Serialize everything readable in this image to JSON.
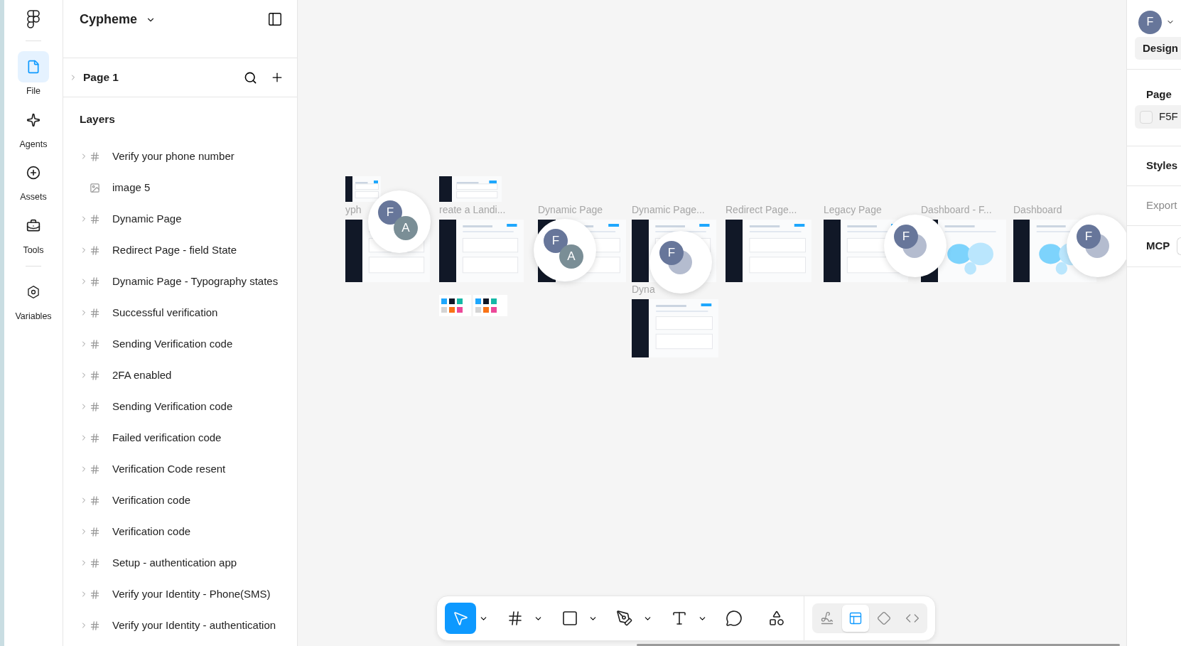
{
  "rail": {
    "items": [
      {
        "kind": "file",
        "label": "File",
        "selected": true
      },
      {
        "kind": "agents",
        "label": "Agents",
        "selected": false
      },
      {
        "kind": "assets",
        "label": "Assets",
        "selected": false
      },
      {
        "kind": "tools",
        "label": "Tools",
        "selected": false
      },
      {
        "kind": "variables",
        "label": "Variables",
        "selected": false
      }
    ]
  },
  "file": {
    "title": "Cypheme"
  },
  "page_row": {
    "label": "Page 1"
  },
  "layers": {
    "title": "Layers",
    "items": [
      {
        "kind": "frame",
        "label": "Verify your phone number"
      },
      {
        "kind": "image",
        "label": "image 5"
      },
      {
        "kind": "frame",
        "label": "Dynamic Page"
      },
      {
        "kind": "frame",
        "label": "Redirect Page - field State"
      },
      {
        "kind": "frame",
        "label": "Dynamic Page - Typography states"
      },
      {
        "kind": "frame",
        "label": "Successful verification"
      },
      {
        "kind": "frame",
        "label": "Sending Verification code"
      },
      {
        "kind": "frame",
        "label": "2FA enabled"
      },
      {
        "kind": "frame",
        "label": "Sending Verification code"
      },
      {
        "kind": "frame",
        "label": "Failed verification code"
      },
      {
        "kind": "frame",
        "label": "Verification Code resent"
      },
      {
        "kind": "frame",
        "label": "Verification code"
      },
      {
        "kind": "frame",
        "label": "Verification code"
      },
      {
        "kind": "frame",
        "label": "Setup - authentication app"
      },
      {
        "kind": "frame",
        "label": "Verify your Identity - Phone(SMS)"
      },
      {
        "kind": "frame",
        "label": "Verify your Identity - authentication"
      }
    ]
  },
  "canvas": {
    "frames": [
      {
        "kind": "page",
        "label": "yph"
      },
      {
        "kind": "page",
        "label": "reate a Landi..."
      },
      {
        "kind": "page",
        "label": "Dynamic Page"
      },
      {
        "kind": "page",
        "label": "Dynamic Page..."
      },
      {
        "kind": "page",
        "label": "Dyna"
      },
      {
        "kind": "page",
        "label": "Redirect Page..."
      },
      {
        "kind": "page",
        "label": "Legacy Page"
      },
      {
        "kind": "map",
        "label": "Dashboard - F..."
      },
      {
        "kind": "map",
        "label": "Dashboard"
      },
      {
        "kind": "page"
      },
      {
        "kind": "page"
      },
      {
        "kind": "swatches"
      },
      {
        "kind": "swatches"
      }
    ],
    "cursors": [
      {
        "avatars": [
          {
            "initial": "F",
            "color": "#67769a"
          },
          {
            "initial": "A",
            "color": "#7a8e96"
          }
        ]
      },
      {
        "avatars": [
          {
            "initial": "F",
            "color": "#67769a"
          },
          {
            "initial": "A",
            "color": "#7a8e96"
          }
        ]
      },
      {
        "avatars": [
          {
            "initial": "F",
            "color": "#67769a"
          },
          {
            "color": "#b4bccf"
          }
        ]
      },
      {
        "avatars": [
          {
            "initial": "F",
            "color": "#67769a"
          },
          {
            "color": "#b4bccf"
          }
        ]
      },
      {
        "avatars": [
          {
            "initial": "F",
            "color": "#67769a"
          },
          {
            "color": "#b4bccf"
          }
        ]
      }
    ]
  },
  "toolbar": {
    "tools": [
      {
        "kind": "move",
        "selected": true,
        "dropdown": true
      },
      {
        "kind": "frame",
        "selected": false,
        "dropdown": true
      },
      {
        "kind": "rectangle",
        "selected": false,
        "dropdown": true
      },
      {
        "kind": "pen",
        "selected": false,
        "dropdown": true
      },
      {
        "kind": "text",
        "selected": false,
        "dropdown": true
      },
      {
        "kind": "comment",
        "selected": false,
        "dropdown": false
      },
      {
        "kind": "actions",
        "selected": false,
        "dropdown": false
      }
    ],
    "modes": [
      {
        "kind": "draw",
        "selected": false
      },
      {
        "kind": "design",
        "selected": true
      },
      {
        "kind": "dev",
        "selected": false
      },
      {
        "kind": "code",
        "selected": false
      }
    ]
  },
  "right_panel": {
    "user": {
      "initial": "F",
      "color": "#67769a"
    },
    "tabs": [
      {
        "label": "Design",
        "selected": true
      }
    ],
    "sections": [
      {
        "kind": "heading",
        "label": "Page",
        "disabled": false
      },
      {
        "kind": "swatch",
        "label": "F5F",
        "disabled": false
      },
      {
        "kind": "heading",
        "label": "Styles",
        "disabled": false
      },
      {
        "kind": "heading",
        "label": "Export",
        "disabled": true
      },
      {
        "kind": "mcp",
        "label": "MCP",
        "disabled": false
      }
    ]
  }
}
